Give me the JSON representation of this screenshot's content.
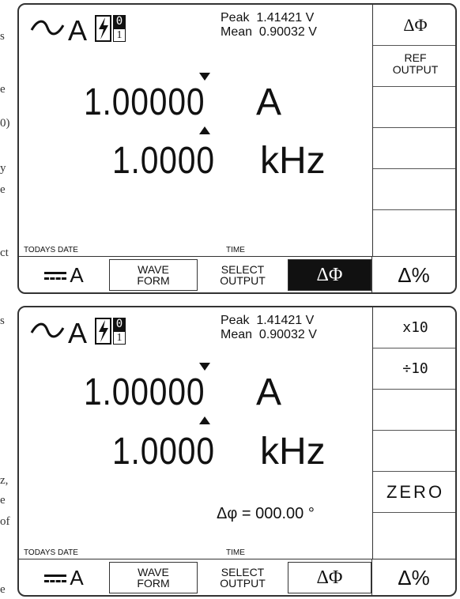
{
  "edge_fragments": [
    "s",
    "e",
    "0)",
    "y",
    "e",
    "ct",
    "s",
    "z,",
    "e",
    "of",
    "e"
  ],
  "screens": [
    {
      "function": {
        "wave_symbol": "sine-wave-icon",
        "unit": "A",
        "range_top": "0",
        "range_bottom": "1"
      },
      "peak": "Peak  1.41421 V",
      "mean": "Mean  0.90032 V",
      "value": "1.00000",
      "value_unit": "A",
      "frequency": "1.0000",
      "frequency_unit": "kHz",
      "todays_date_label": "TODAYS DATE",
      "time_label": "TIME",
      "right_keys": [
        "ΔΦ",
        "REF\nOUTPUT",
        "",
        "",
        "",
        ""
      ],
      "bottom_keys": {
        "dc": "A",
        "wave_form": "WAVE\nFORM",
        "select_output": "SELECT\nOUTPUT",
        "delta_phi": "ΔΦ",
        "delta_percent": "Δ%"
      },
      "delta_phi_active": true
    },
    {
      "function": {
        "wave_symbol": "sine-wave-icon",
        "unit": "A",
        "range_top": "0",
        "range_bottom": "1"
      },
      "peak": "Peak  1.41421 V",
      "mean": "Mean  0.90032 V",
      "value": "1.00000",
      "value_unit": "A",
      "frequency": "1.0000",
      "frequency_unit": "kHz",
      "phase": "Δφ = 000.00 °",
      "todays_date_label": "TODAYS DATE",
      "time_label": "TIME",
      "right_keys": [
        "x10",
        "÷10",
        "",
        "",
        "ZERO",
        ""
      ],
      "bottom_keys": {
        "dc": "A",
        "wave_form": "WAVE\nFORM",
        "select_output": "SELECT\nOUTPUT",
        "delta_phi": "ΔΦ",
        "delta_percent": "Δ%"
      },
      "delta_phi_active": false
    }
  ]
}
